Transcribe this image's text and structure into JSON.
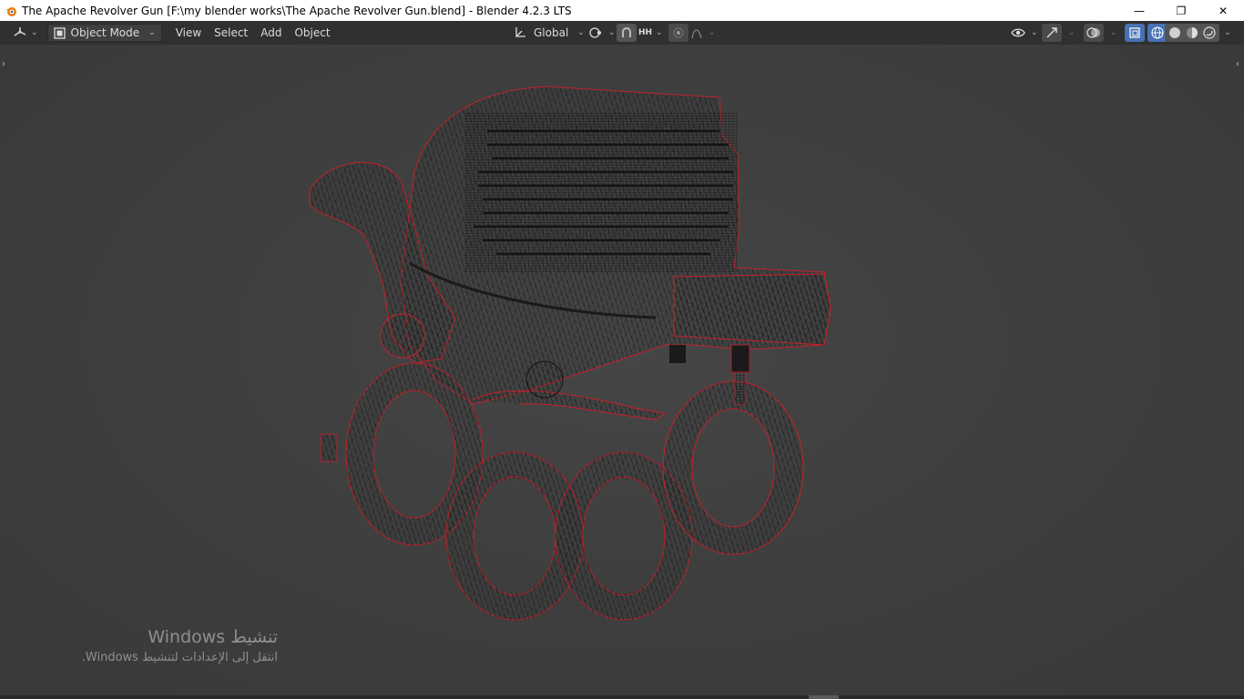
{
  "window": {
    "title": "The Apache Revolver Gun [F:\\my blender works\\The Apache Revolver Gun.blend] - Blender 4.2.3 LTS",
    "controls": {
      "minimize": "—",
      "restore": "❐",
      "close": "✕"
    }
  },
  "header": {
    "editor_type_icon": "editor-type-icon",
    "mode": "Object Mode",
    "menus": [
      "View",
      "Select",
      "Add",
      "Object"
    ],
    "transform_orientation": "Global",
    "snap_increment": "HH"
  },
  "overlay": {
    "activation_title": "تنشيط Windows",
    "activation_subtitle": "انتقل إلى الإعدادات لتنشيط Windows."
  },
  "colors": {
    "header_bg": "#303030",
    "viewport_bg": "#3f3f3f",
    "selection_outline": "#c8202a",
    "wire": "#1a1a1a",
    "active_button": "#4772b3"
  }
}
